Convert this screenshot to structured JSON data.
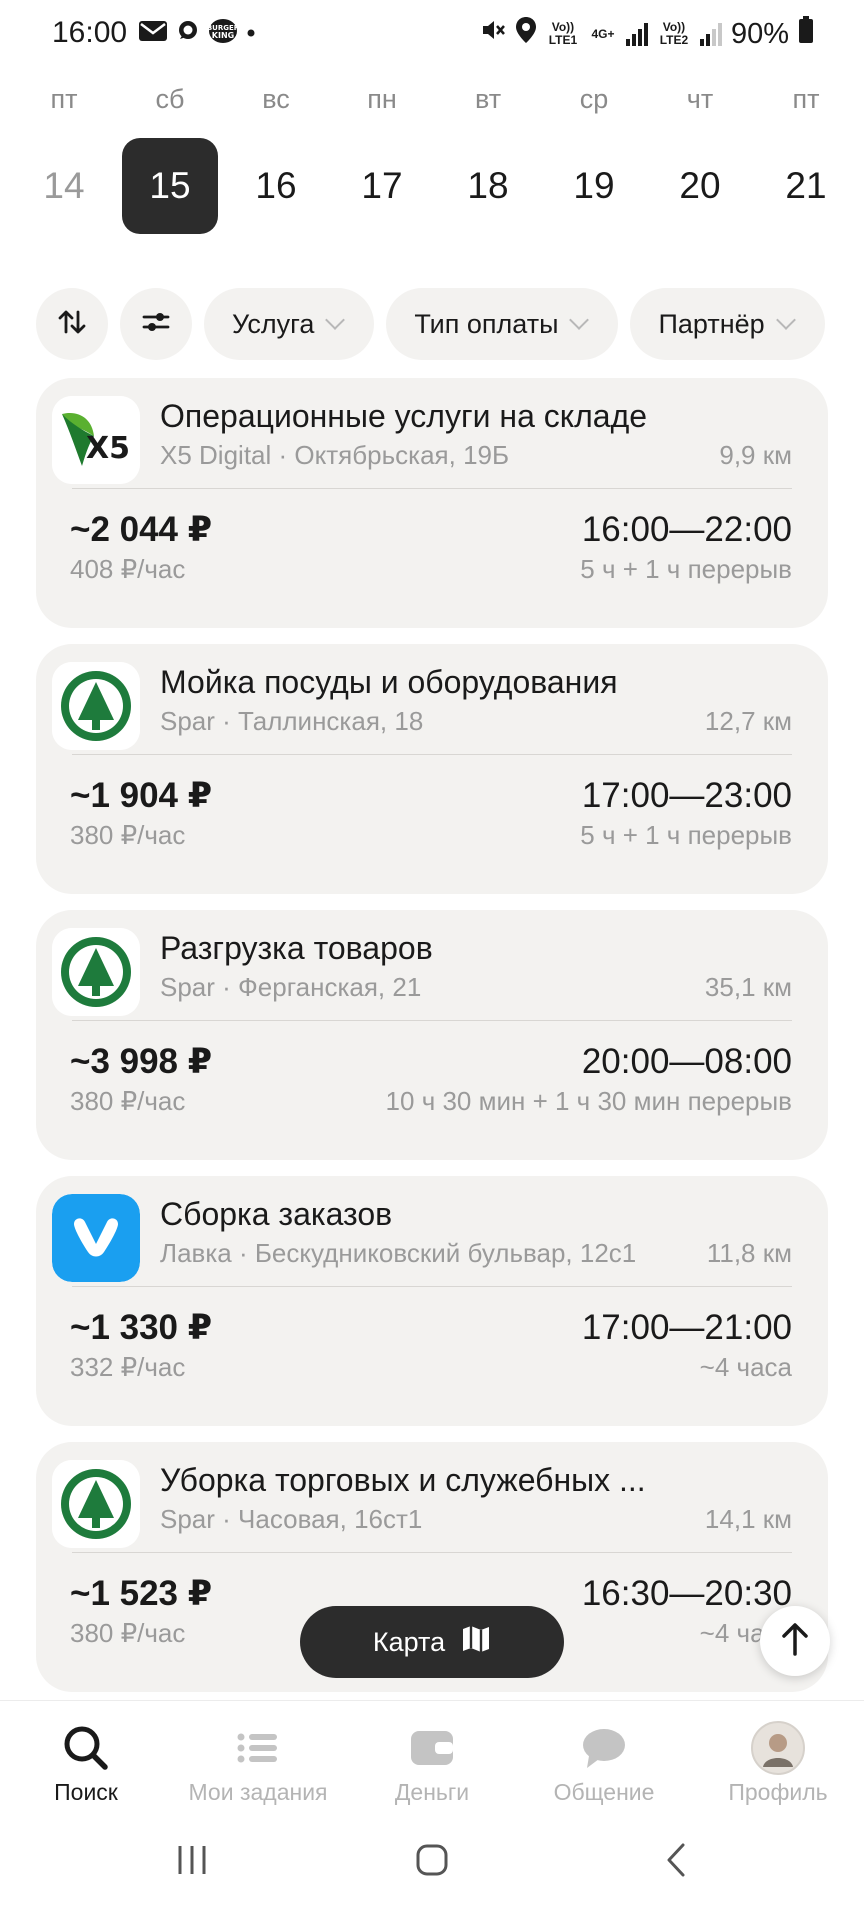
{
  "status_bar": {
    "time": "16:00",
    "icons": [
      "mail-icon",
      "chat-bubble-icon",
      "burger-king-icon",
      "dot-icon"
    ],
    "right_icons": [
      "mute-icon",
      "location-icon",
      "volte-lte1-icon",
      "4g-icon",
      "signal-icon",
      "volte-lte2-icon",
      "signal-2-icon",
      "battery-icon"
    ],
    "lte1_label": "Vo)) LTE1",
    "lte2_label": "Vo)) LTE2",
    "net_label": "4G+",
    "battery": "90%"
  },
  "calendar": {
    "days": [
      {
        "weekday": "пт",
        "date": "14",
        "state": "past"
      },
      {
        "weekday": "сб",
        "date": "15",
        "state": "selected"
      },
      {
        "weekday": "вс",
        "date": "16",
        "state": "normal"
      },
      {
        "weekday": "пн",
        "date": "17",
        "state": "normal"
      },
      {
        "weekday": "вт",
        "date": "18",
        "state": "normal"
      },
      {
        "weekday": "ср",
        "date": "19",
        "state": "normal"
      },
      {
        "weekday": "чт",
        "date": "20",
        "state": "normal"
      },
      {
        "weekday": "пт",
        "date": "21",
        "state": "normal"
      }
    ]
  },
  "filters": {
    "sort_icon": "sort-arrows-icon",
    "settings_icon": "sliders-icon",
    "service": "Услуга",
    "payment_type": "Тип оплаты",
    "partner": "Партнёр"
  },
  "jobs": [
    {
      "logo": "x5-logo",
      "logo_text": "X5",
      "title": "Операционные услуги на складе",
      "subtitle": "X5 Digital · Октябрьская, 19Б",
      "distance": "9,9 км",
      "price": "~2 044 ₽",
      "rate": "408 ₽/час",
      "time": "16:00—22:00",
      "duration": "5 ч + 1 ч перерыв"
    },
    {
      "logo": "spar-logo",
      "title": "Мойка посуды и оборудования",
      "subtitle": "Spar · Таллинская, 18",
      "distance": "12,7 км",
      "price": "~1 904 ₽",
      "rate": "380 ₽/час",
      "time": "17:00—23:00",
      "duration": "5 ч + 1 ч перерыв"
    },
    {
      "logo": "spar-logo",
      "title": "Разгрузка товаров",
      "subtitle": "Spar · Ферганская, 21",
      "distance": "35,1 км",
      "price": "~3 998 ₽",
      "rate": "380 ₽/час",
      "time": "20:00—08:00",
      "duration": "10 ч 30 мин + 1 ч 30 мин перерыв"
    },
    {
      "logo": "lavka-logo",
      "title": "Сборка заказов",
      "subtitle": "Лавка · Бескудниковский бульвар, 12с1",
      "distance": "11,8 км",
      "price": "~1 330 ₽",
      "rate": "332 ₽/час",
      "time": "17:00—21:00",
      "duration": "~4 часа"
    },
    {
      "logo": "spar-logo",
      "title": "Уборка торговых и служебных ...",
      "subtitle": "Spar · Часовая, 16ст1",
      "distance": "14,1 км",
      "price": "~1 523 ₽",
      "rate": "380 ₽/час",
      "time": "16:30—20:30",
      "duration": "~4 часа"
    }
  ],
  "map_button": {
    "label": "Карта",
    "icon": "map-icon"
  },
  "scroll_top_icon": "arrow-up-icon",
  "bottom_nav": [
    {
      "label": "Поиск",
      "icon": "search-icon",
      "active": true
    },
    {
      "label": "Мои задания",
      "icon": "list-icon",
      "active": false
    },
    {
      "label": "Деньги",
      "icon": "wallet-icon",
      "active": false
    },
    {
      "label": "Общение",
      "icon": "chat-icon",
      "active": false
    },
    {
      "label": "Профиль",
      "icon": "avatar-icon",
      "active": false
    }
  ],
  "system_nav": [
    "recents-icon",
    "home-icon",
    "back-icon"
  ],
  "colors": {
    "accent_dark": "#2c2c2c",
    "card_bg": "#f3f2f0",
    "spar_green": "#1e7b3c",
    "lavka_blue": "#1a9ff0",
    "x5_green": "#5ab030"
  }
}
